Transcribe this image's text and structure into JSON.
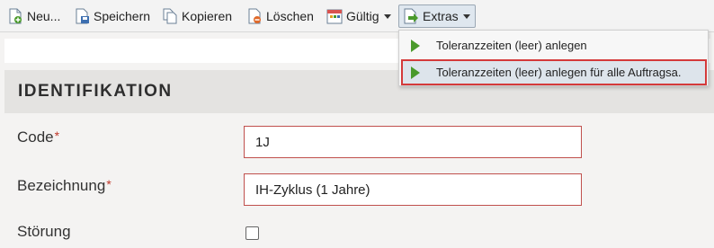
{
  "toolbar": {
    "new_label": "Neu...",
    "save_label": "Speichern",
    "copy_label": "Kopieren",
    "delete_label": "Löschen",
    "valid_label": "Gültig",
    "extras_label": "Extras"
  },
  "extras_menu": {
    "items": [
      {
        "label": "Toleranzzeiten (leer) anlegen"
      },
      {
        "label": "Toleranzzeiten (leer) anlegen für alle Auftragsa."
      }
    ]
  },
  "section": {
    "title": "IDENTIFIKATION"
  },
  "form": {
    "code": {
      "label": "Code",
      "required_mark": "*",
      "value": "1J"
    },
    "description": {
      "label": "Bezeichnung",
      "required_mark": "*",
      "value": "IH-Zyklus (1 Jahre)"
    },
    "fault": {
      "label": "Störung",
      "checked": false
    }
  },
  "colors": {
    "accent_green": "#4a9a2b",
    "error_border": "#c0504d",
    "required": "#c0392b"
  }
}
